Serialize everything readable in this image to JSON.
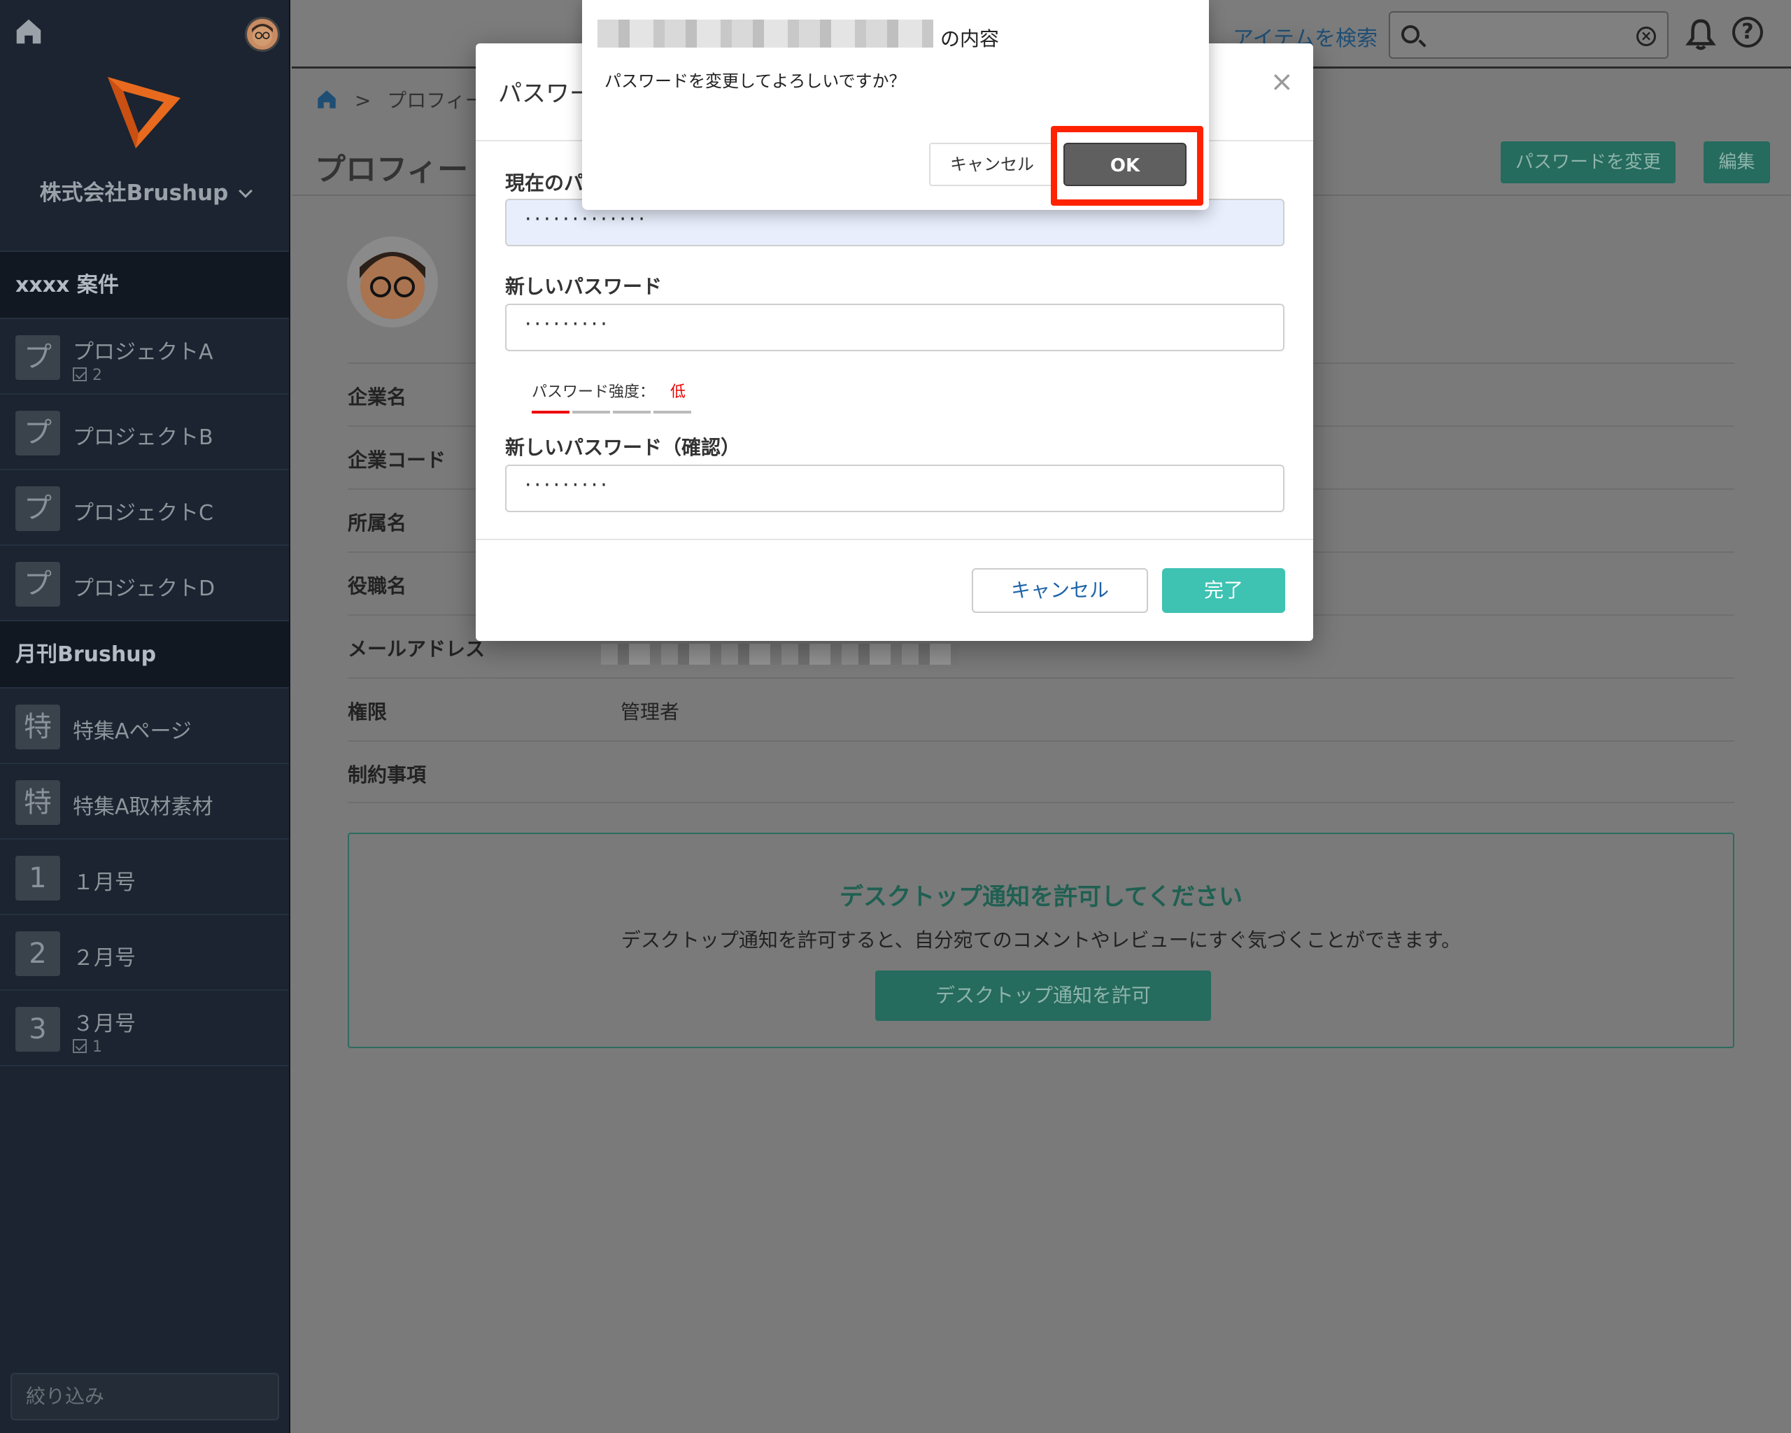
{
  "sidebar": {
    "org_name": "株式会社Brushup",
    "groups": [
      {
        "title": "xxxx 案件",
        "items": [
          {
            "badge": "プ",
            "label": "プロジェクトA",
            "count": "2"
          },
          {
            "badge": "プ",
            "label": "プロジェクトB"
          },
          {
            "badge": "プ",
            "label": "プロジェクトC"
          },
          {
            "badge": "プ",
            "label": "プロジェクトD"
          }
        ]
      },
      {
        "title": "月刊Brushup",
        "items": [
          {
            "badge": "特",
            "label": "特集Aページ"
          },
          {
            "badge": "特",
            "label": "特集A取材素材"
          },
          {
            "badge": "1",
            "label": "１月号"
          },
          {
            "badge": "2",
            "label": "２月号"
          },
          {
            "badge": "3",
            "label": "３月号",
            "count": "1"
          }
        ]
      }
    ],
    "filter_placeholder": "絞り込み"
  },
  "topbar": {
    "search_link": "アイテムを検索",
    "search_clear": "×",
    "help": "?"
  },
  "breadcrumb": {
    "separator": ">",
    "current": "プロフィー"
  },
  "page": {
    "title": "プロフィー",
    "change_password_button": "パスワードを変更",
    "edit_button": "編集"
  },
  "profile": {
    "rows": [
      {
        "key": "企業名",
        "value": ""
      },
      {
        "key": "企業コード",
        "value": ""
      },
      {
        "key": "所属名",
        "value": ""
      },
      {
        "key": "役職名",
        "value": ""
      },
      {
        "key": "メールアドレス",
        "value": ""
      },
      {
        "key": "権限",
        "value": "管理者"
      },
      {
        "key": "制約事項",
        "value": ""
      }
    ]
  },
  "notice": {
    "title": "デスクトップ通知を許可してください",
    "description": "デスクトップ通知を許可すると、自分宛てのコメントやレビューにすぐ気づくことができます。",
    "button": "デスクトップ通知を許可"
  },
  "password_modal": {
    "title": "パスワー",
    "close": "×",
    "current_label": "現在のパ",
    "current_value": "·············",
    "new_label": "新しいパスワード",
    "new_value": "·········",
    "strength_label": "パスワード強度：",
    "strength_value": "低",
    "strength_level": 1,
    "strength_max": 4,
    "confirm_label": "新しいパスワード（確認）",
    "confirm_value": "·········",
    "cancel": "キャンセル",
    "done": "完了"
  },
  "confirm_dialog": {
    "title_suffix": "の内容",
    "message": "パスワードを変更してよろしいですか？",
    "cancel": "キャンセル",
    "ok": "OK"
  },
  "colors": {
    "accent": "#3ec2b2",
    "highlight": "#ff2200",
    "strength_low": "#e00000"
  }
}
